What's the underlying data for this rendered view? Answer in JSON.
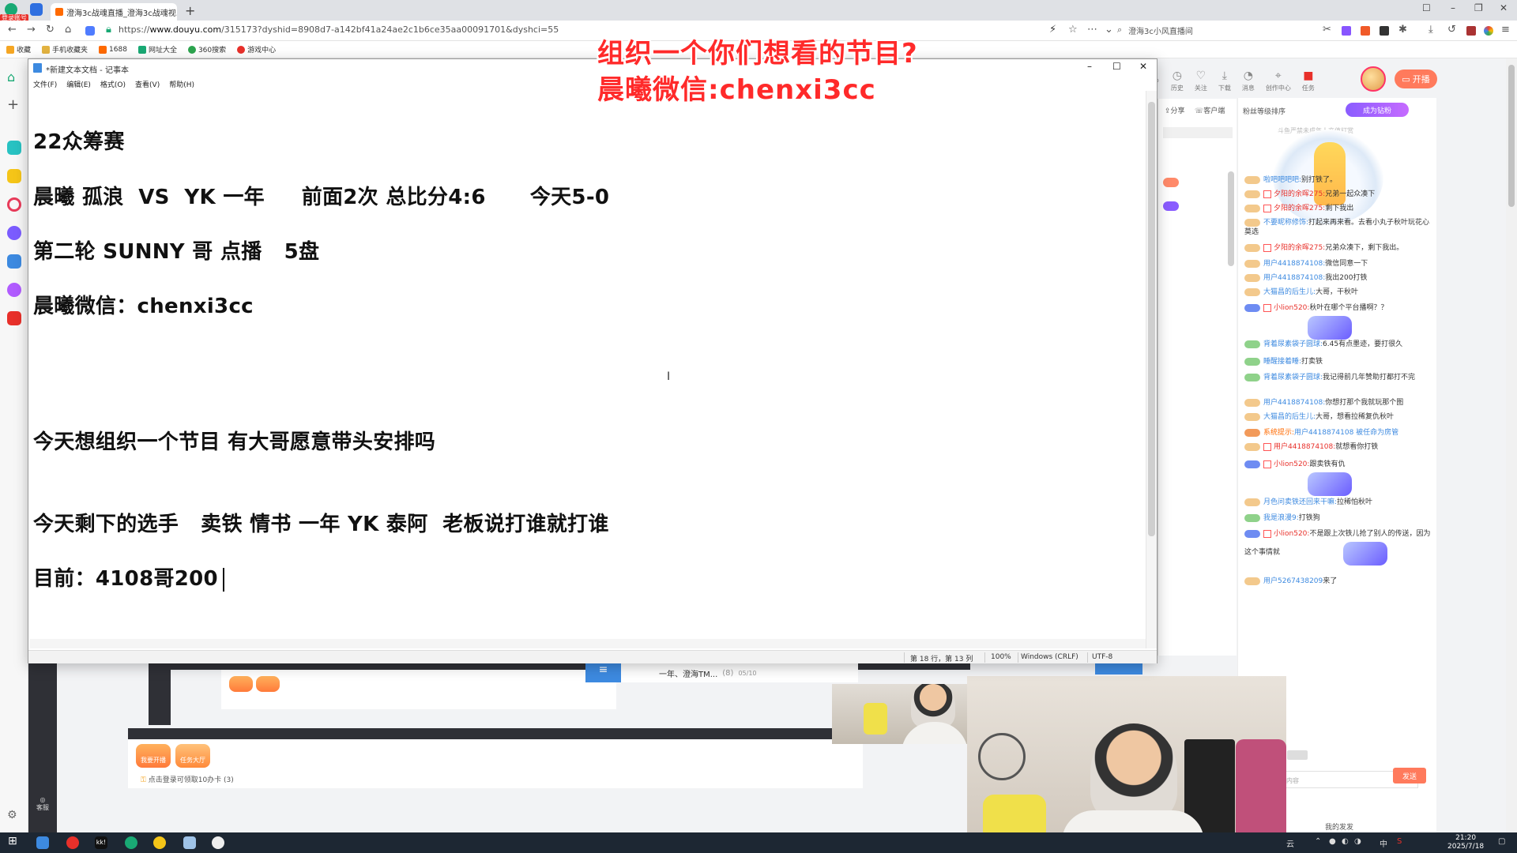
{
  "browser": {
    "login_badge": "登录账号",
    "tab_title": "澄海3c战魂直播_澄海3c战魂视...",
    "url_prefix": "https://",
    "url_domain": "www.douyu.com",
    "url_rest": "/315173?dyshid=8908d7-a142bf41a24ae2c1b6ce35aa00091701&dyshci=55",
    "search_placeholder": "澄海3c小风直播间",
    "bookmarks": [
      "收藏",
      "手机收藏夹",
      "1688",
      "网址大全",
      "360搜索",
      "游戏中心"
    ]
  },
  "overlay": {
    "line1": "组织一个你们想看的节目?",
    "line2": "晨曦微信:chenxi3cc"
  },
  "notepad": {
    "title": "*新建文本文档 - 记事本",
    "menu": [
      "文件(F)",
      "编辑(E)",
      "格式(O)",
      "查看(V)",
      "帮助(H)"
    ],
    "lines": [
      "22众筹赛",
      "晨曦 孤浪  VS  YK 一年     前面2次 总比分4:6      今天5-0",
      "第二轮 SUNNY 哥 点播   5盘",
      "晨曦微信：chenxi3cc",
      "今天想组织一个节目 有大哥愿意带头安排吗",
      "今天剩下的选手   卖铁 情书 一年 YK 泰阿  老板说打谁就打谁",
      "目前：4108哥200"
    ],
    "status": {
      "position": "第 18 行，第 13 列",
      "zoom": "100%",
      "line_ending": "Windows (CRLF)",
      "encoding": "UTF-8"
    }
  },
  "douyu_top": {
    "items": [
      "历史",
      "关注",
      "下载",
      "消息",
      "创作中心",
      "任务"
    ],
    "live_button": "开播"
  },
  "mini_panel": {
    "share": "分享",
    "client": "客户端"
  },
  "chat": {
    "fans_header": "粉丝等级排序",
    "fans_badge": "成为钻粉",
    "fans_sub": "斗鱼严禁未成年人充值打赏",
    "messages": [
      {
        "lv": "",
        "nick": "啦吧吧吧吧:",
        "text": "别打铁了。"
      },
      {
        "lv": "",
        "nick": "夕阳的余晖275:",
        "text": "兄弟一起众凑下"
      },
      {
        "lv": "",
        "nick": "夕阳的余晖275:",
        "text": "剩下我出"
      },
      {
        "lv": "",
        "nick": "不要昵称修饰:",
        "text": "打起来再来看。去看小丸子秋叶玩花心莫选"
      },
      {
        "lv": "",
        "nick": "夕阳的余晖275:",
        "text": "兄弟众凑下，剩下我出。"
      },
      {
        "lv": "",
        "nick": "用户4418874108:",
        "text": "微信同意一下"
      },
      {
        "lv": "",
        "nick": "用户4418874108:",
        "text": "我出200打铁"
      },
      {
        "lv": "",
        "nick": "大猫昌的后生儿:",
        "text": "大哥，干秋叶"
      },
      {
        "lv": "",
        "nick": "小lion520:",
        "text": "秋叶在哪个平台播啊？？"
      },
      {
        "lv": "",
        "nick": "背着尿素袋子圆球:",
        "text": "6.45有点墨迹，要打很久"
      },
      {
        "lv": "",
        "nick": "睡醒接着睡:",
        "text": "打卖铁"
      },
      {
        "lv": "",
        "nick": "背着尿素袋子圆球:",
        "text": "我记得前几年赞助打都打不完"
      },
      {
        "lv": "",
        "nick": "用户4418874108:",
        "text": "你想打那个我就玩那个图"
      },
      {
        "lv": "",
        "nick": "大猫昌的后生儿:",
        "text": "大哥，想看拉稀复仇秋叶"
      },
      {
        "lv": "",
        "nick": "系统提示:",
        "text": "用户4418874108 被任命为房管"
      },
      {
        "lv": "",
        "nick": "用户4418874108:",
        "text": "就想看你打铁"
      },
      {
        "lv": "",
        "nick": "小lion520:",
        "text": "跟卖铁有仇"
      },
      {
        "lv": "",
        "nick": "月色问卖铁还回来干嘛:",
        "text": "拉稀怕秋叶"
      },
      {
        "lv": "",
        "nick": "我是浪漫9:",
        "text": "打铁狗"
      },
      {
        "lv": "",
        "nick": "小lion520:",
        "text": "不是跟上次铁儿抢了别人的传送，因为这个事情就"
      },
      {
        "lv": "",
        "nick": "用户5267438209",
        "text": "来了"
      }
    ],
    "input_placeholder": "这里输入聊天内容",
    "send": "发送",
    "my_fans": "我的发发"
  },
  "lower": {
    "chat_tab": "一年、澄海TM...",
    "chat_count": "(8)",
    "chat_ratio": "05/10",
    "btn_open": "我要开播",
    "btn_task": "任务大厅",
    "hint": "点击登录可领取10办卡 (3)",
    "service": "客服"
  },
  "taskbar": {
    "time": "21:20",
    "date": "2025/7/18",
    "tray_text": "云",
    "ime": "中"
  }
}
